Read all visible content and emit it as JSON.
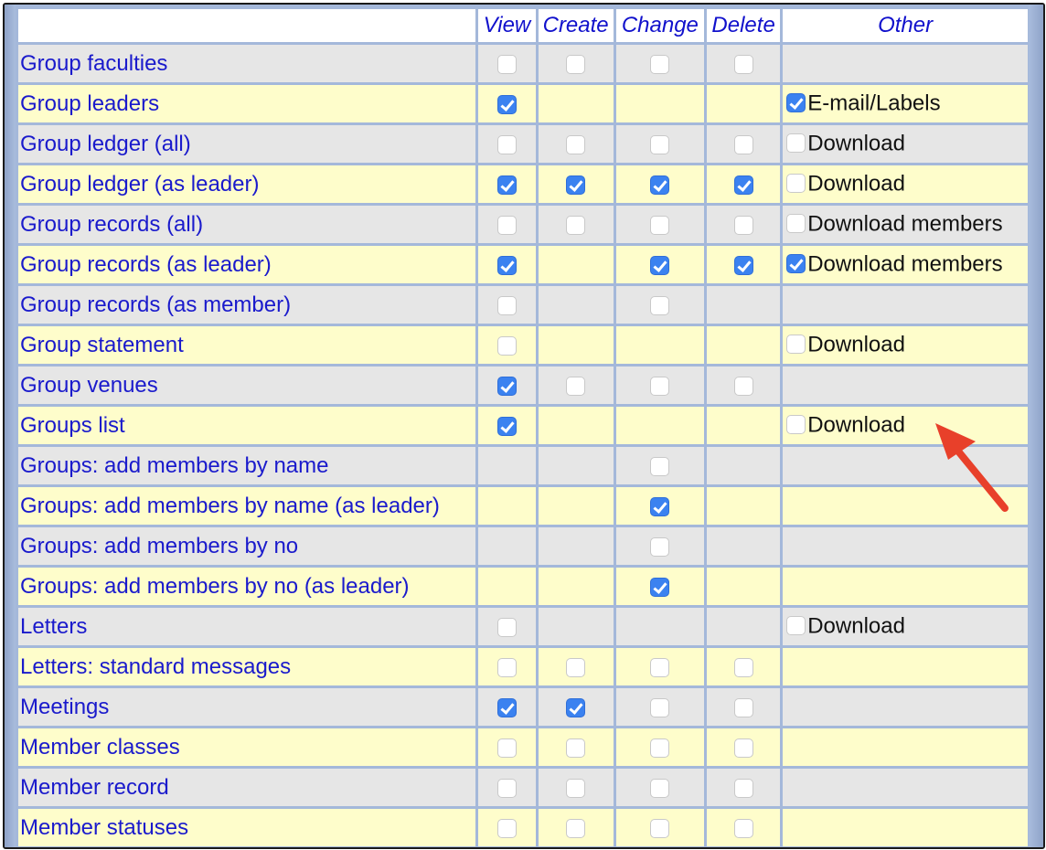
{
  "headers": {
    "name": "",
    "view": "View",
    "create": "Create",
    "change": "Change",
    "delete": "Delete",
    "other": "Other"
  },
  "rows": [
    {
      "name": "Group faculties",
      "view": "off",
      "create": "off",
      "change": "off",
      "delete": "off",
      "other_label": "",
      "other": "none"
    }
  ],
  "colors": {
    "link_blue": "#1a1acc",
    "header_blue": "#1111cc",
    "row_grey": "#e6e6e6",
    "row_yellow": "#fefdcb",
    "border_blue": "#a4b8da",
    "checkbox_blue": "#3b82f0",
    "arrow_red": "#e8402a"
  },
  "annotation": {
    "icon": "red-arrow-icon",
    "target": "Groups list download"
  }
}
